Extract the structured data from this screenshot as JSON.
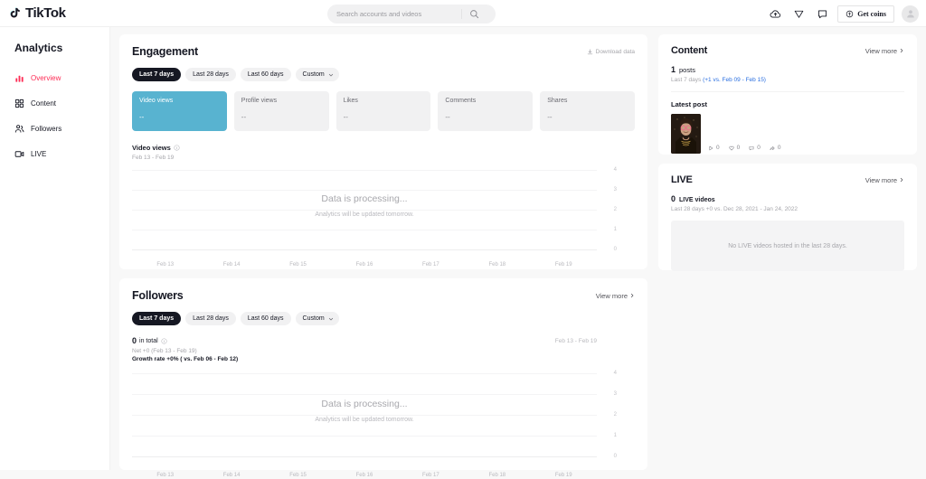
{
  "brand": {
    "name": "TikTok",
    "accent": "#fe2c55",
    "active_tile": "#58b3d0",
    "link_blue": "#2a6fe0"
  },
  "topbar": {
    "search": {
      "placeholder": "Search accounts and videos",
      "value": ""
    },
    "upload_icon": "cloud-upload-icon",
    "send_icon": "paper-plane-icon",
    "message_icon": "message-icon",
    "coins_label": "Get coins",
    "coins_icon": "coin-icon",
    "avatar_icon": "avatar-icon"
  },
  "sidebar": {
    "title": "Analytics",
    "items": [
      {
        "label": "Overview",
        "icon": "chart-bar-icon",
        "active": true
      },
      {
        "label": "Content",
        "icon": "grid-icon",
        "active": false
      },
      {
        "label": "Followers",
        "icon": "people-icon",
        "active": false
      },
      {
        "label": "LIVE",
        "icon": "live-video-icon",
        "active": false
      }
    ]
  },
  "engagement": {
    "title": "Engagement",
    "download_label": "Download data",
    "filters": [
      {
        "label": "Last 7 days",
        "active": true
      },
      {
        "label": "Last 28 days",
        "active": false
      },
      {
        "label": "Last 60 days",
        "active": false
      },
      {
        "label": "Custom",
        "active": false,
        "caret": true
      }
    ],
    "tiles": [
      {
        "label": "Video views",
        "value": "--",
        "active": true
      },
      {
        "label": "Profile views",
        "value": "--",
        "active": false
      },
      {
        "label": "Likes",
        "value": "--",
        "active": false
      },
      {
        "label": "Comments",
        "value": "--",
        "active": false
      },
      {
        "label": "Shares",
        "value": "--",
        "active": false
      }
    ],
    "chart_metric": "Video views",
    "chart_range": "Feb 13 - Feb 19",
    "empty_title": "Data is processing...",
    "empty_sub": "Analytics will be updated tomorrow."
  },
  "followers": {
    "title": "Followers",
    "view_more": "View more",
    "filters": [
      {
        "label": "Last 7 days",
        "active": true
      },
      {
        "label": "Last 28 days",
        "active": false
      },
      {
        "label": "Last 60 days",
        "active": false
      },
      {
        "label": "Custom",
        "active": false,
        "caret": true
      }
    ],
    "total_number": "0",
    "total_label": "in total",
    "net": "Net +0 (Feb 13 - Feb 19)",
    "growth": "Growth rate +0% ( vs. Feb 06 - Feb 12)",
    "range": "Feb 13 - Feb 19",
    "empty_title": "Data is processing...",
    "empty_sub": "Analytics will be updated tomorrow."
  },
  "content": {
    "title": "Content",
    "view_more": "View more",
    "posts_number": "1",
    "posts_label": "posts",
    "posts_sub_prefix": "Last 7 days ",
    "posts_sub_accent": "(+1 vs. Feb 09 - Feb 15)",
    "latest_label": "Latest post",
    "post_stats": [
      {
        "icon": "play-icon",
        "value": "0"
      },
      {
        "icon": "heart-icon",
        "value": "0"
      },
      {
        "icon": "comment-icon",
        "value": "0"
      },
      {
        "icon": "share-icon",
        "value": "0"
      }
    ]
  },
  "live": {
    "title": "LIVE",
    "view_more": "View more",
    "videos_number": "0",
    "videos_label": "LIVE videos",
    "sub": "Last 28 days +0 vs. Dec 28, 2021 - Jan 24, 2022",
    "empty": "No LIVE videos hosted in the last 28 days."
  },
  "chart_data": [
    {
      "type": "line",
      "title": "Video views",
      "subtitle": "Feb 13 - Feb 19",
      "x": [
        "Feb 13",
        "Feb 14",
        "Feb 15",
        "Feb 16",
        "Feb 17",
        "Feb 18",
        "Feb 19"
      ],
      "values": [
        null,
        null,
        null,
        null,
        null,
        null,
        null
      ],
      "yticks": [
        4,
        3,
        2,
        1,
        0
      ],
      "ylim": [
        0,
        4
      ],
      "xlabel": "",
      "ylabel": "",
      "grid": true,
      "legend": "none",
      "annotations": [
        "Data is processing...",
        "Analytics will be updated tomorrow."
      ]
    },
    {
      "type": "line",
      "title": "Followers",
      "subtitle": "Feb 13 - Feb 19",
      "x": [
        "Feb 13",
        "Feb 14",
        "Feb 15",
        "Feb 16",
        "Feb 17",
        "Feb 18",
        "Feb 19"
      ],
      "values": [
        null,
        null,
        null,
        null,
        null,
        null,
        null
      ],
      "yticks": [
        4,
        3,
        2,
        1,
        0
      ],
      "ylim": [
        0,
        4
      ],
      "xlabel": "",
      "ylabel": "",
      "grid": true,
      "legend": "none",
      "annotations": [
        "Data is processing...",
        "Analytics will be updated tomorrow."
      ]
    }
  ]
}
